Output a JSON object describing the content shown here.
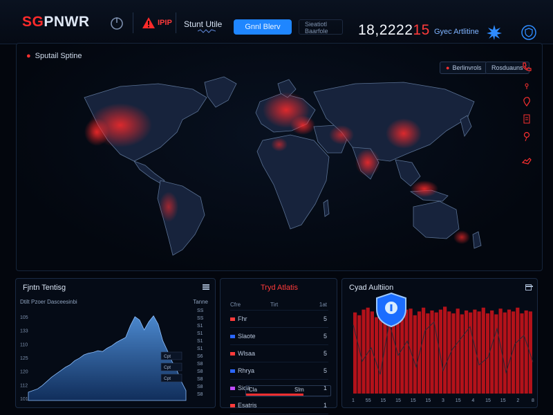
{
  "header": {
    "brand_part1": "SG",
    "brand_part2": "PNWR",
    "alert_label": "IPIP",
    "status_label": "Stunt Utile",
    "primary_button": "Gnnl Blerv",
    "sub_box_line1": "Sieatiotl",
    "sub_box_line2": "Baarfole",
    "counter_main": "18,2222",
    "counter_red": "15",
    "activity_label": "Gyec Artlitine",
    "icons": [
      "brand-icon",
      "alert-icon",
      "status-icon",
      "burst-icon",
      "shield-icon"
    ]
  },
  "map": {
    "title": "Sputail Sptine",
    "btn_left": "Berlinvrols",
    "btn_right": "Rosduauns",
    "side_tools": [
      "phone-icon",
      "signal-icon",
      "location-icon",
      "document-icon",
      "pin-icon",
      "handset-icon"
    ],
    "colors": {
      "land": "#17233c",
      "border": "#5b7294",
      "hot": "#ff2222"
    }
  },
  "trend_panel": {
    "title": "Fjntn Tentisg",
    "menu_icon": "menu-icon",
    "sub_header_left": "Dtilt Pzoer Dasceesinbi",
    "sub_header_right": "Tanne",
    "y_labels": [
      "105",
      "133",
      "110",
      "125",
      "120",
      "112",
      "101"
    ],
    "right_labels": [
      "SS",
      "SS",
      "S1",
      "S1",
      "S1",
      "S1",
      "S6",
      "S8",
      "S8",
      "S8",
      "S8",
      "S8"
    ],
    "tooltips": [
      "Cpt",
      "Cpt",
      "Cpt"
    ],
    "chart_data": {
      "type": "area",
      "values": [
        10,
        12,
        14,
        18,
        23,
        28,
        32,
        36,
        40,
        43,
        48,
        51,
        55,
        57,
        58,
        60,
        59,
        63,
        66,
        70,
        73,
        76,
        90,
        101,
        97,
        85,
        95,
        102,
        92,
        72,
        60,
        47,
        37,
        23,
        12
      ]
    }
  },
  "threats_panel": {
    "title": "Tryd Atlatis",
    "headers": [
      "Cfre",
      "Tirt",
      "1at"
    ],
    "rows": [
      {
        "name": "Fhr",
        "num": "5",
        "color": "#ff3b3b"
      },
      {
        "name": "Slaote",
        "num": "5",
        "color": "#2a66ff"
      },
      {
        "name": "Wlsaa",
        "num": "5",
        "color": "#ff3b3b"
      },
      {
        "name": "Rhrya",
        "num": "5",
        "color": "#2a66ff"
      },
      {
        "name": "Sida",
        "num": "1",
        "color": "#c04bff"
      },
      {
        "name": "Esatris",
        "num": "1",
        "color": "#ff3b3b"
      }
    ],
    "progress_left": "Cla",
    "progress_right": "Slm",
    "progress_value": 0.68
  },
  "activity_panel": {
    "title": "Cyad Aultiion",
    "shield_icon": "shield-icon",
    "x_labels": [
      "1",
      "55",
      "15",
      "15",
      "15",
      "15",
      "3",
      "15",
      "4",
      "15",
      "15",
      "2",
      "8"
    ],
    "chart_data": {
      "type": "bar",
      "values": [
        85,
        82,
        88,
        90,
        86,
        80,
        84,
        83,
        87,
        91,
        85,
        84,
        88,
        89,
        82,
        86,
        90,
        84,
        87,
        85,
        88,
        91,
        86,
        84,
        89,
        83,
        87,
        85,
        88,
        86,
        90,
        84,
        87,
        83,
        89,
        85,
        88,
        86,
        90,
        84,
        87,
        86
      ],
      "line": [
        72,
        34,
        48,
        20,
        74,
        40,
        55,
        28,
        66,
        75,
        24,
        46,
        58,
        70,
        30,
        38,
        68,
        22,
        52,
        61,
        33
      ]
    }
  }
}
